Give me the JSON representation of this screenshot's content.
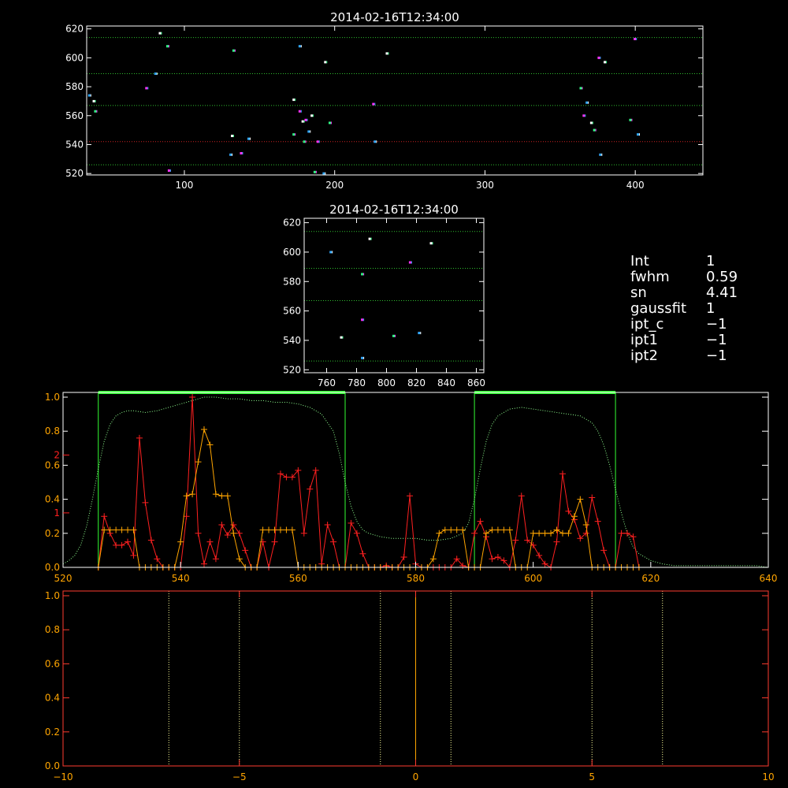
{
  "colors": {
    "background": "#000000",
    "axes": "#ffffff",
    "spectrum": "#ff2020",
    "smoothed": "#ffa500",
    "filter": "#33ff33",
    "bottom_axes": "#ff3b2f",
    "bottom_ticks": "#ffa500",
    "dotted_line": "#ffff99"
  },
  "info": [
    {
      "key": "Int",
      "value": "1"
    },
    {
      "key": "fwhm",
      "value": "0.59"
    },
    {
      "key": "sn",
      "value": "4.41"
    },
    {
      "key": "gaussfit",
      "value": "1"
    },
    {
      "key": "ipt_c",
      "value": "−1"
    },
    {
      "key": "ipt1",
      "value": "−1"
    },
    {
      "key": "ipt2",
      "value": "−1"
    }
  ],
  "chart_data": [
    {
      "type": "scatter",
      "title": "2014-02-16T12:34:00",
      "xlim": [
        35,
        445
      ],
      "ylim": [
        519,
        622
      ],
      "xticks": [
        100,
        200,
        300,
        400
      ],
      "yticks": [
        520,
        540,
        560,
        580,
        600,
        620
      ],
      "hlines_green": [
        614,
        589,
        567,
        526
      ],
      "hlines_red": [
        542
      ],
      "points": [
        {
          "x": 37,
          "y": 574
        },
        {
          "x": 40,
          "y": 570
        },
        {
          "x": 41,
          "y": 563
        },
        {
          "x": 75,
          "y": 579
        },
        {
          "x": 81,
          "y": 589
        },
        {
          "x": 84,
          "y": 617
        },
        {
          "x": 89,
          "y": 608
        },
        {
          "x": 90,
          "y": 522
        },
        {
          "x": 131,
          "y": 533
        },
        {
          "x": 132,
          "y": 546
        },
        {
          "x": 133,
          "y": 605
        },
        {
          "x": 138,
          "y": 534
        },
        {
          "x": 143,
          "y": 544
        },
        {
          "x": 173,
          "y": 571
        },
        {
          "x": 173,
          "y": 547
        },
        {
          "x": 177,
          "y": 563
        },
        {
          "x": 177,
          "y": 608
        },
        {
          "x": 179,
          "y": 556
        },
        {
          "x": 180,
          "y": 542
        },
        {
          "x": 181,
          "y": 557
        },
        {
          "x": 183,
          "y": 549
        },
        {
          "x": 185,
          "y": 560
        },
        {
          "x": 187,
          "y": 521
        },
        {
          "x": 189,
          "y": 542
        },
        {
          "x": 193,
          "y": 520
        },
        {
          "x": 194,
          "y": 597
        },
        {
          "x": 197,
          "y": 555
        },
        {
          "x": 226,
          "y": 568
        },
        {
          "x": 227,
          "y": 542
        },
        {
          "x": 235,
          "y": 603
        },
        {
          "x": 364,
          "y": 579
        },
        {
          "x": 366,
          "y": 560
        },
        {
          "x": 368,
          "y": 569
        },
        {
          "x": 371,
          "y": 555
        },
        {
          "x": 373,
          "y": 550
        },
        {
          "x": 376,
          "y": 600
        },
        {
          "x": 377,
          "y": 533
        },
        {
          "x": 380,
          "y": 597
        },
        {
          "x": 397,
          "y": 557
        },
        {
          "x": 400,
          "y": 613
        },
        {
          "x": 402,
          "y": 547
        }
      ]
    },
    {
      "type": "scatter",
      "title": "2014-02-16T12:34:00",
      "xlim": [
        745,
        865
      ],
      "ylim": [
        518,
        623
      ],
      "xticks": [
        760,
        780,
        800,
        820,
        840,
        860
      ],
      "yticks": [
        520,
        540,
        560,
        580,
        600,
        620
      ],
      "hlines_green": [
        614,
        589,
        567,
        526
      ],
      "points": [
        {
          "x": 763,
          "y": 600
        },
        {
          "x": 770,
          "y": 542
        },
        {
          "x": 784,
          "y": 585
        },
        {
          "x": 784,
          "y": 554
        },
        {
          "x": 784,
          "y": 528
        },
        {
          "x": 789,
          "y": 609
        },
        {
          "x": 805,
          "y": 543
        },
        {
          "x": 816,
          "y": 593
        },
        {
          "x": 822,
          "y": 545
        },
        {
          "x": 830,
          "y": 606
        }
      ]
    },
    {
      "type": "line",
      "xlim": [
        520,
        640
      ],
      "ylim": [
        0,
        1.0
      ],
      "xticks": [
        520,
        540,
        560,
        580,
        600,
        620,
        640
      ],
      "yticks": [
        0.0,
        0.2,
        0.4,
        0.6,
        0.8,
        1.0
      ],
      "yticks_right_labels": [
        "2",
        "1"
      ],
      "filter_bands": [
        [
          526,
          568
        ],
        [
          590,
          614
        ]
      ],
      "series": [
        {
          "x": [
            520,
            521,
            522,
            523,
            524,
            525,
            526,
            527,
            528,
            529,
            530,
            531,
            532,
            534,
            536,
            538,
            540,
            542,
            544,
            546,
            548,
            550,
            552,
            554,
            556,
            558,
            560,
            562,
            564,
            566,
            567,
            568,
            569,
            570,
            571,
            572,
            573,
            574,
            576,
            578,
            580,
            582,
            584,
            586,
            588,
            589,
            590,
            591,
            592,
            593,
            594,
            596,
            598,
            600,
            602,
            604,
            606,
            608,
            610,
            611,
            612,
            613,
            614,
            615,
            616,
            617,
            618,
            620,
            622,
            624,
            626,
            628,
            630,
            632,
            634,
            636,
            638,
            640
          ],
          "y": [
            0.02,
            0.04,
            0.07,
            0.13,
            0.24,
            0.4,
            0.58,
            0.74,
            0.84,
            0.89,
            0.91,
            0.92,
            0.92,
            0.91,
            0.92,
            0.94,
            0.96,
            0.98,
            1.0,
            1.0,
            0.99,
            0.99,
            0.98,
            0.98,
            0.97,
            0.97,
            0.96,
            0.94,
            0.9,
            0.8,
            0.67,
            0.5,
            0.36,
            0.27,
            0.22,
            0.2,
            0.19,
            0.18,
            0.17,
            0.17,
            0.17,
            0.16,
            0.16,
            0.17,
            0.2,
            0.26,
            0.4,
            0.58,
            0.74,
            0.84,
            0.89,
            0.93,
            0.94,
            0.93,
            0.92,
            0.91,
            0.9,
            0.89,
            0.85,
            0.8,
            0.72,
            0.6,
            0.46,
            0.32,
            0.2,
            0.12,
            0.08,
            0.04,
            0.02,
            0.01,
            0.01,
            0.01,
            0.01,
            0.01,
            0.01,
            0.01,
            0.01,
            0.0
          ]
        },
        {
          "x": [
            526,
            527,
            528,
            529,
            530,
            531,
            532,
            533,
            534,
            535,
            536,
            537,
            538,
            539,
            540,
            541,
            542,
            543,
            544,
            545,
            546,
            547,
            548,
            549,
            550,
            551,
            552,
            553,
            554,
            555,
            556,
            557,
            558,
            559,
            560,
            561,
            562,
            563,
            564,
            565,
            566,
            567,
            568,
            569,
            570,
            571,
            572,
            573,
            574,
            575,
            576,
            577,
            578,
            579,
            580,
            581,
            582,
            583,
            584,
            585,
            586,
            587,
            588,
            589,
            590,
            591,
            592,
            593,
            594,
            595,
            596,
            597,
            598,
            599,
            600,
            601,
            602,
            603,
            604,
            605,
            606,
            607,
            608,
            609,
            610,
            611,
            612,
            613,
            614,
            615,
            616,
            617,
            618
          ],
          "y": [
            0.0,
            0.3,
            0.2,
            0.13,
            0.13,
            0.15,
            0.07,
            0.76,
            0.38,
            0.16,
            0.05,
            0.0,
            0.0,
            0.0,
            0.0,
            0.3,
            1.0,
            0.2,
            0.02,
            0.15,
            0.05,
            0.25,
            0.19,
            0.25,
            0.2,
            0.1,
            0.0,
            0.0,
            0.15,
            0.0,
            0.15,
            0.55,
            0.53,
            0.53,
            0.57,
            0.2,
            0.46,
            0.57,
            0.02,
            0.25,
            0.15,
            0.0,
            0.0,
            0.26,
            0.2,
            0.08,
            0.0,
            0.0,
            0.0,
            0.01,
            0.0,
            0.0,
            0.06,
            0.42,
            0.02,
            0.0,
            0.0,
            0.0,
            0.0,
            0.0,
            0.0,
            0.05,
            0.01,
            0.0,
            0.2,
            0.27,
            0.18,
            0.05,
            0.06,
            0.04,
            0.0,
            0.16,
            0.42,
            0.16,
            0.13,
            0.07,
            0.02,
            0.0,
            0.15,
            0.55,
            0.33,
            0.28,
            0.17,
            0.2,
            0.41,
            0.27,
            0.1,
            0.0,
            0.0,
            0.2,
            0.2,
            0.18,
            0.0
          ]
        },
        {
          "x": [
            526,
            527,
            528,
            529,
            530,
            531,
            532,
            533,
            534,
            535,
            536,
            537,
            538,
            539,
            540,
            541,
            542,
            543,
            544,
            545,
            546,
            547,
            548,
            549,
            550,
            551,
            552,
            553,
            554,
            555,
            556,
            557,
            558,
            559,
            560,
            561,
            562,
            563,
            564,
            565,
            566,
            567,
            568,
            569,
            570,
            571,
            572,
            573,
            574,
            575,
            576,
            577,
            578,
            579,
            580,
            581,
            582,
            583,
            584,
            585,
            586,
            587,
            588,
            589,
            590,
            591,
            592,
            593,
            594,
            595,
            596,
            597,
            598,
            599,
            600,
            601,
            602,
            603,
            604,
            605,
            606,
            607,
            608,
            609,
            610,
            611,
            612,
            613,
            614,
            615,
            616,
            617,
            618
          ],
          "y": [
            0.0,
            0.22,
            0.22,
            0.22,
            0.22,
            0.22,
            0.22,
            0.0,
            0.0,
            0.0,
            0.0,
            0.0,
            0.0,
            0.0,
            0.15,
            0.42,
            0.43,
            0.62,
            0.81,
            0.72,
            0.43,
            0.42,
            0.42,
            0.2,
            0.05,
            0.0,
            0.0,
            0.0,
            0.22,
            0.22,
            0.22,
            0.22,
            0.22,
            0.22,
            0.0,
            0.0,
            0.0,
            0.0,
            0.0,
            0.0,
            0.0,
            0.0,
            0.0,
            0.0,
            0.0,
            0.0,
            0.0,
            0.0,
            0.0,
            0.0,
            0.0,
            0.0,
            0.0,
            0.0,
            0.0,
            0.0,
            0.0,
            0.05,
            0.2,
            0.22,
            0.22,
            0.22,
            0.22,
            0.0,
            0.0,
            0.0,
            0.2,
            0.22,
            0.22,
            0.22,
            0.22,
            0.0,
            0.0,
            0.0,
            0.2,
            0.2,
            0.2,
            0.2,
            0.22,
            0.2,
            0.2,
            0.3,
            0.4,
            0.25,
            0.0,
            0.0,
            0.0,
            0.0,
            0.0,
            0.0,
            0.0,
            0.0,
            0.0
          ]
        }
      ]
    },
    {
      "type": "line",
      "xlim": [
        -10,
        10
      ],
      "ylim": [
        0,
        1.0
      ],
      "xticks": [
        -10,
        -5,
        0,
        5,
        10
      ],
      "yticks": [
        0.0,
        0.2,
        0.4,
        0.6,
        0.8,
        1.0
      ],
      "dotted_vlines": [
        -7,
        -5,
        -1,
        1,
        5,
        7
      ],
      "center_line": 0
    }
  ]
}
